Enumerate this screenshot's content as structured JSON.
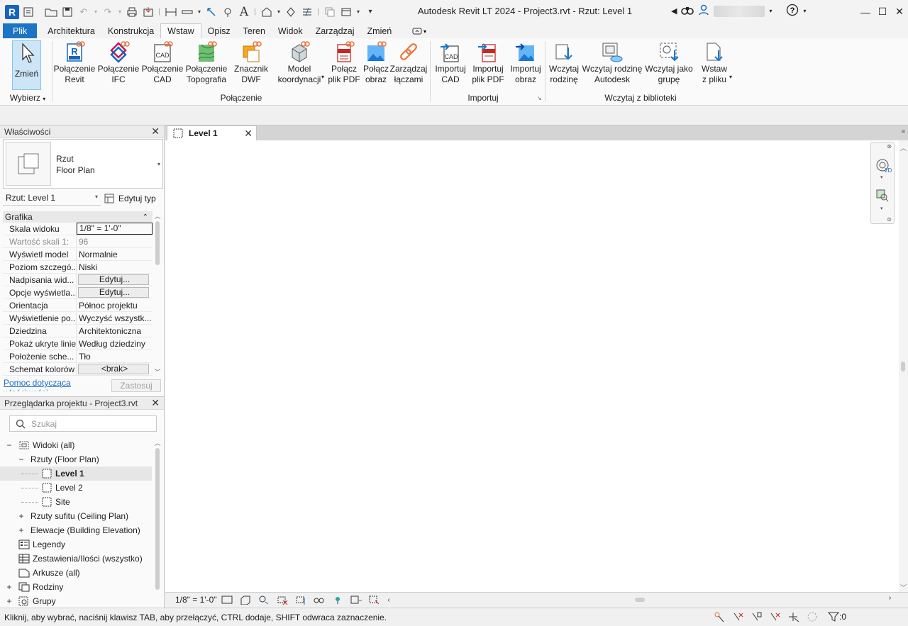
{
  "window": {
    "title": "Autodesk Revit LT 2024 - Project3.rvt - Rzut: Level 1",
    "user_name_blurred": ""
  },
  "menu_tabs": [
    "Plik",
    "Architektura",
    "Konstrukcja",
    "Wstaw",
    "Opisz",
    "Teren",
    "Widok",
    "Zarządzaj",
    "Zmień"
  ],
  "active_tab": "Wstaw",
  "ribbon": {
    "select": {
      "modify_line1": "Zmień",
      "panel_label": "Wybierz"
    },
    "link_panel": {
      "label": "Połączenie",
      "buttons": [
        {
          "line1": "Połączenie",
          "line2": "Revit"
        },
        {
          "line1": "Połączenie",
          "line2": "IFC"
        },
        {
          "line1": "Połączenie",
          "line2": "CAD"
        },
        {
          "line1": "Połączenie",
          "line2": "Topografia"
        },
        {
          "line1": "Znacznik",
          "line2": "DWF"
        },
        {
          "line1": "Model",
          "line2": "koordynacji"
        },
        {
          "line1": "Połącz",
          "line2": "plik PDF"
        },
        {
          "line1": "Połącz",
          "line2": "obraz"
        },
        {
          "line1": "Zarządzaj",
          "line2": "łączami"
        }
      ]
    },
    "import_panel": {
      "label": "Importuj",
      "buttons": [
        {
          "line1": "Importuj",
          "line2": "CAD"
        },
        {
          "line1": "Importuj",
          "line2": "plik PDF"
        },
        {
          "line1": "Importuj",
          "line2": "obraz"
        }
      ]
    },
    "library_panel": {
      "label": "Wczytaj z biblioteki",
      "buttons": [
        {
          "line1": "Wczytaj",
          "line2": "rodzinę"
        },
        {
          "line1": "Wczytaj rodzinę",
          "line2": "Autodesk"
        },
        {
          "line1": "Wczytaj jako",
          "line2": "grupę"
        },
        {
          "line1": "Wstaw",
          "line2": "z pliku"
        }
      ]
    }
  },
  "properties": {
    "title": "Właściwości",
    "type_line1": "Rzut",
    "type_line2": "Floor Plan",
    "view_selector": "Rzut: Level 1",
    "edit_type": "Edytuj typ",
    "group": "Grafika",
    "rows": [
      {
        "name": "Skala widoku",
        "value": "1/8\" = 1'-0\""
      },
      {
        "name": "Wartość skali   1:",
        "value": "96"
      },
      {
        "name": "Wyświetl model",
        "value": "Normalnie"
      },
      {
        "name": "Poziom szczegó...",
        "value": "Niski"
      },
      {
        "name": "Nadpisania wid...",
        "value": "Edytuj..."
      },
      {
        "name": "Opcje wyświetla...",
        "value": "Edytuj..."
      },
      {
        "name": "Orientacja",
        "value": "Północ projektu"
      },
      {
        "name": "Wyświetlenie po...",
        "value": "Wyczyść wszystk..."
      },
      {
        "name": "Dziedzina",
        "value": "Architektoniczna"
      },
      {
        "name": "Pokaż ukryte linie",
        "value": "Według dziedziny"
      },
      {
        "name": "Położenie sche...",
        "value": "Tło"
      },
      {
        "name": "Schemat kolorów",
        "value": "<brak>"
      }
    ],
    "help_link": "Pomoc dotycząca właściwości",
    "apply": "Zastosuj"
  },
  "browser": {
    "title": "Przeglądarka projektu - Project3.rvt",
    "search_placeholder": "Szukaj",
    "tree": [
      {
        "label": "Widoki (all)",
        "toggle": "−"
      },
      {
        "label": "Rzuty (Floor Plan)",
        "toggle": "−"
      },
      {
        "label": "Level 1",
        "toggle": ""
      },
      {
        "label": "Level 2",
        "toggle": ""
      },
      {
        "label": "Site",
        "toggle": ""
      },
      {
        "label": "Rzuty sufitu (Ceiling Plan)",
        "toggle": "+"
      },
      {
        "label": "Elewacje (Building Elevation)",
        "toggle": "+"
      },
      {
        "label": "Legendy",
        "toggle": ""
      },
      {
        "label": "Zestawienia/Ilości (wszystko)",
        "toggle": ""
      },
      {
        "label": "Arkusze (all)",
        "toggle": ""
      },
      {
        "label": "Rodziny",
        "toggle": "+"
      },
      {
        "label": "Grupy",
        "toggle": "+"
      }
    ]
  },
  "document_tab": "Level 1",
  "view_control": {
    "scale": "1/8\" = 1'-0\""
  },
  "status": {
    "message": "Kliknij, aby wybrać, naciśnij klawisz TAB, aby przełączyć, CTRL dodaje, SHIFT odwraca zaznaczenie.",
    "filter_count": ":0"
  },
  "colors": {
    "file_tab": "#1c74c4",
    "accent_blue": "#1a6fc0",
    "link_orange": "#e8743b"
  }
}
